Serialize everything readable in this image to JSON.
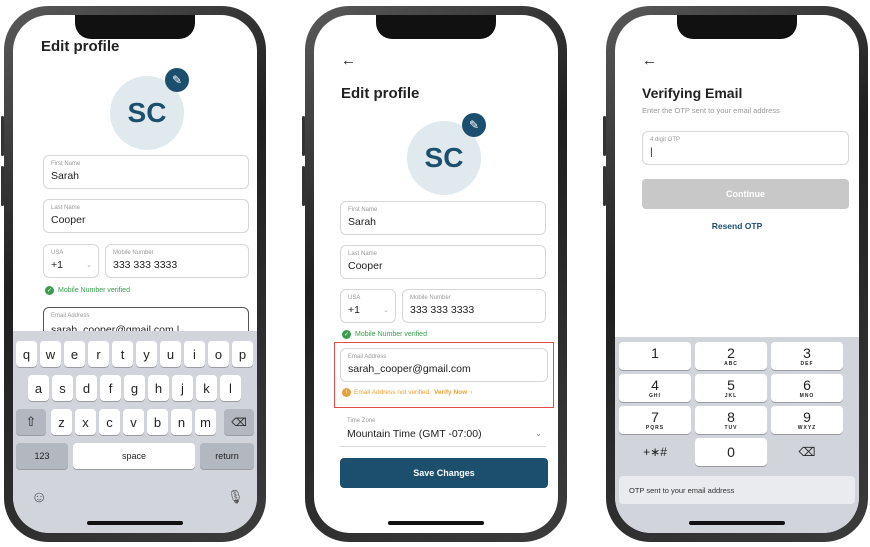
{
  "screen1": {
    "title": "Edit profile",
    "initials": "SC",
    "first_name_label": "First Name",
    "first_name": "Sarah",
    "last_name_label": "Last Name",
    "last_name": "Cooper",
    "country": "USA",
    "code": "+1",
    "mobile_label": "Mobile Number",
    "mobile": "333 333 3333",
    "mobile_status": "Mobile Number verified",
    "email_label": "Email Address",
    "email": "sarah_cooper@gmail.com |",
    "keys_row1": [
      "q",
      "w",
      "e",
      "r",
      "t",
      "y",
      "u",
      "i",
      "o",
      "p"
    ],
    "keys_row2": [
      "a",
      "s",
      "d",
      "f",
      "g",
      "h",
      "j",
      "k",
      "l"
    ],
    "keys_row3": [
      "z",
      "x",
      "c",
      "v",
      "b",
      "n",
      "m"
    ],
    "key_123": "123",
    "key_space": "space",
    "key_return": "return"
  },
  "screen2": {
    "back": "←",
    "title": "Edit profile",
    "initials": "SC",
    "first_name_label": "First Name",
    "first_name": "Sarah",
    "last_name_label": "Last Name",
    "last_name": "Cooper",
    "country": "USA",
    "code": "+1",
    "mobile_label": "Mobile Number",
    "mobile": "333 333 3333",
    "mobile_status": "Mobile Number verified",
    "email_label": "Email Address",
    "email": "sarah_cooper@gmail.com",
    "email_warning": "Email Address not verified.",
    "verify_now": "Verify Now",
    "timezone_label": "Time Zone",
    "timezone": "Mountain Time (GMT -07:00)",
    "save": "Save Changes",
    "highlight_color": "#e34b4b"
  },
  "screen3": {
    "back": "←",
    "title": "Verifying Email",
    "subtitle": "Enter the OTP sent to your email address",
    "otp_label": "4 digit OTP",
    "otp_value": "|",
    "continue": "Continue",
    "resend": "Resend OTP",
    "notice": "OTP sent to your email address",
    "pad": [
      {
        "d": "1",
        "l": ""
      },
      {
        "d": "2",
        "l": "ABC"
      },
      {
        "d": "3",
        "l": "DEF"
      },
      {
        "d": "4",
        "l": "GHI"
      },
      {
        "d": "5",
        "l": "JKL"
      },
      {
        "d": "6",
        "l": "MNO"
      },
      {
        "d": "7",
        "l": "PQRS"
      },
      {
        "d": "8",
        "l": "TUV"
      },
      {
        "d": "9",
        "l": "WXYZ"
      }
    ],
    "sym": "+∗#",
    "zero": "0"
  },
  "colors": {
    "primary": "#1c4f6e",
    "success": "#3a9d4e",
    "warning": "#e8a03a"
  }
}
